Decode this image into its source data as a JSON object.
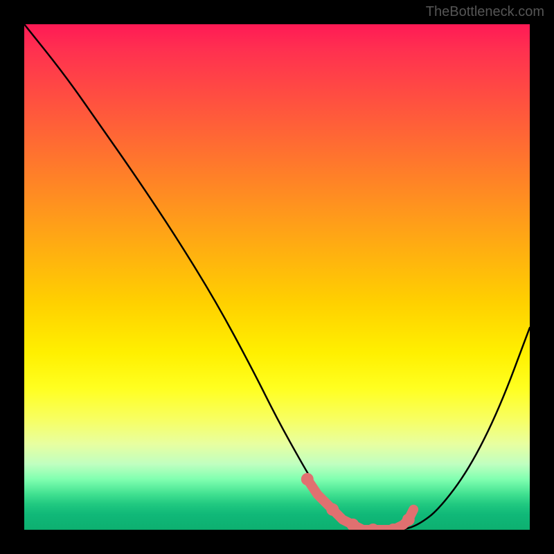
{
  "watermark": "TheBottleneck.com",
  "chart_data": {
    "type": "line",
    "title": "",
    "xlabel": "",
    "ylabel": "",
    "xlim": [
      0,
      100
    ],
    "ylim": [
      0,
      100
    ],
    "series": [
      {
        "name": "bottleneck-curve",
        "x": [
          0,
          8,
          15,
          22,
          30,
          38,
          45,
          50,
          55,
          58,
          60,
          62,
          65,
          68,
          72,
          75,
          78,
          82,
          88,
          94,
          100
        ],
        "values": [
          100,
          90,
          80,
          70,
          58,
          45,
          32,
          22,
          13,
          8,
          5,
          3,
          1,
          0,
          0,
          0,
          1,
          4,
          12,
          24,
          40
        ]
      }
    ],
    "markers": {
      "name": "optimal-range",
      "color": "#e07070",
      "points_x": [
        56,
        58,
        61,
        63,
        65,
        67,
        69,
        71,
        73,
        75,
        76,
        77
      ],
      "points_y": [
        10,
        7,
        4,
        2,
        1,
        0,
        0,
        0,
        0,
        1,
        2,
        4
      ]
    },
    "background_gradient": {
      "top_color": "#ff1a55",
      "mid_color": "#fff000",
      "bottom_color": "#0db070"
    }
  }
}
